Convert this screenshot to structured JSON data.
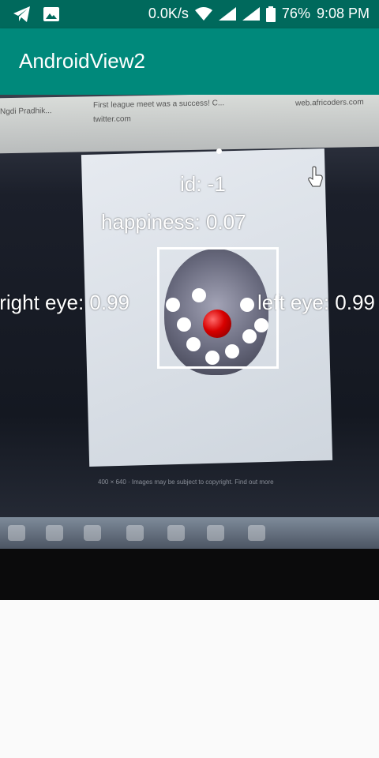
{
  "status_bar": {
    "network_speed": "0.0K/s",
    "battery": "76%",
    "time": "9:08 PM",
    "icons": [
      "telegram-icon",
      "image-icon",
      "wifi-icon",
      "signal-icon",
      "signal-icon",
      "battery-icon"
    ]
  },
  "app_bar": {
    "title": "AndroidView2"
  },
  "camera": {
    "browser_texts": [
      "Ngdi Pradhik...",
      "First league meet was a success! C...",
      "twitter.com",
      "web.africoders.com"
    ],
    "footer_text": "400 × 640 · Images may be subject to copyright. Find out more"
  },
  "overlay": {
    "id_label": "id: -1",
    "happiness_label": "happiness: 0.07",
    "right_eye_label": "right eye: 0.99",
    "left_eye_label": "left eye: 0.99"
  },
  "colors": {
    "status_bar": "#00695c",
    "app_bar": "#00897b",
    "nose_marker": "#d80000"
  }
}
